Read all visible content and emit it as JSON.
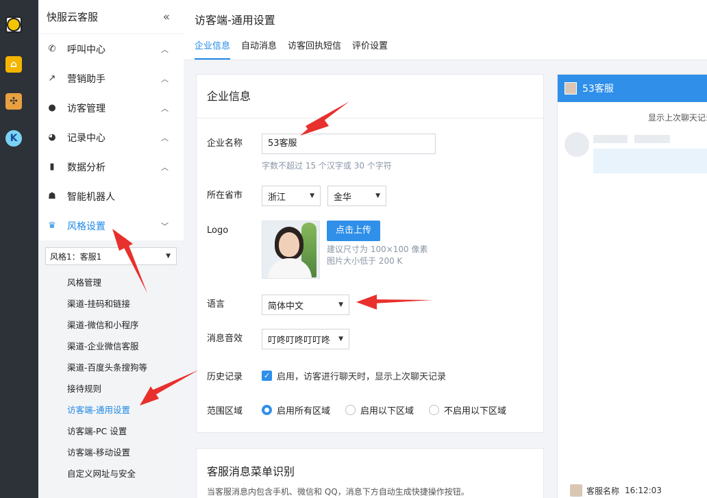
{
  "rail": {
    "items": [
      "logo-icon",
      "home-icon",
      "tools-icon",
      "k-icon"
    ]
  },
  "sidebar": {
    "brand": "快服云客服",
    "collapse": "«",
    "items": [
      {
        "label": "呼叫中心",
        "icon": "phone-icon",
        "chev": "^"
      },
      {
        "label": "营销助手",
        "icon": "trend-icon",
        "chev": "^"
      },
      {
        "label": "访客管理",
        "icon": "user-icon",
        "chev": "^"
      },
      {
        "label": "记录中心",
        "icon": "clock-icon",
        "chev": "^"
      },
      {
        "label": "数据分析",
        "icon": "bar-chart-icon",
        "chev": "^"
      },
      {
        "label": "智能机器人",
        "icon": "robot-icon",
        "chev": ""
      },
      {
        "label": "风格设置",
        "icon": "shirt-icon",
        "chev": "v"
      }
    ],
    "style_select": "风格1：客服1",
    "sub_items": [
      "风格管理",
      "渠道-挂码和链接",
      "渠道-微信和小程序",
      "渠道-企业微信客服",
      "渠道-百度头条搜狗等",
      "接待规则",
      "访客端-通用设置",
      "访客端-PC 设置",
      "访客端-移动设置",
      "自定义网址与安全"
    ],
    "active_sub_index": 6
  },
  "header": {
    "title": "访客端-通用设置",
    "tabs": [
      "企业信息",
      "自动消息",
      "访客回执短信",
      "评价设置"
    ],
    "active_tab": 0
  },
  "company": {
    "card_title": "企业信息",
    "name_label": "企业名称",
    "name_value": "53客服",
    "name_hint": "字数不超过 15 个汉字或 30 个字符",
    "province_label": "所在省市",
    "province": "浙江",
    "city": "金华",
    "logo_label": "Logo",
    "upload_button": "点击上传",
    "logo_hint_1": "建议尺寸为 100×100 像素",
    "logo_hint_2": "图片大小低于 200 K",
    "language_label": "语言",
    "language": "简体中文",
    "sound_label": "消息音效",
    "sound": "叮咚叮咚叮叮咚",
    "history_label": "历史记录",
    "history_text": "启用，访客进行聊天时，显示上次聊天记录",
    "region_label": "范围区域",
    "region_options": [
      "启用所有区域",
      "启用以下区域",
      "不启用以下区域"
    ],
    "region_selected": 0
  },
  "card2": {
    "title": "客服消息菜单识别",
    "desc": "当客服消息内包含手机、微信和 QQ，消息下方自动生成快捷操作按钮。"
  },
  "preview": {
    "name": "53客服",
    "last_chat": "显示上次聊天记录",
    "footer_name": "客服名称",
    "footer_time": "16:12:03"
  },
  "colors": {
    "accent": "#1e88e5",
    "button": "#2f8fe9",
    "annotation": "#e8302c"
  }
}
